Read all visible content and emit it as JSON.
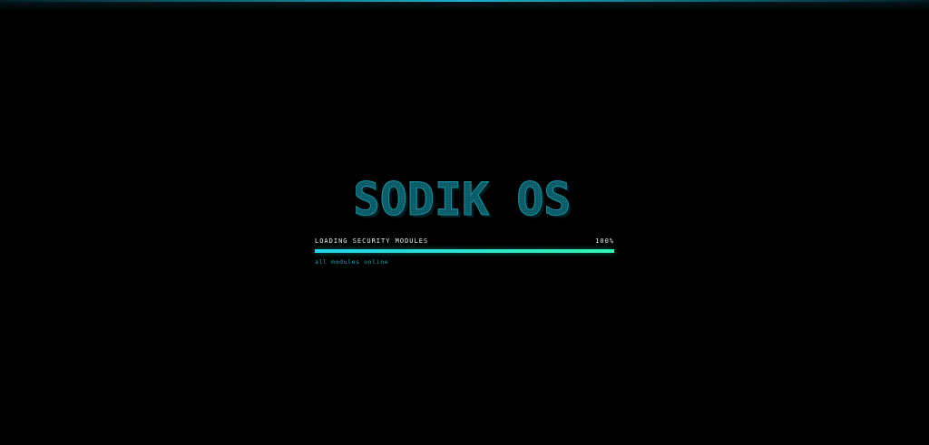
{
  "boot": {
    "logo_text": "SODIK OS",
    "status_label": "LOADING SECURITY MODULES",
    "progress_percent_label": "100%",
    "progress_value": 1.0,
    "sub_status": "all modules online"
  },
  "colors": {
    "background": "#000000",
    "logo_fill": "#0d5f6c",
    "logo_edge": "#1aa3b6",
    "progress_start": "#22d3ee",
    "progress_end": "#34f5b0",
    "sub_status": "#1ea7b8"
  }
}
